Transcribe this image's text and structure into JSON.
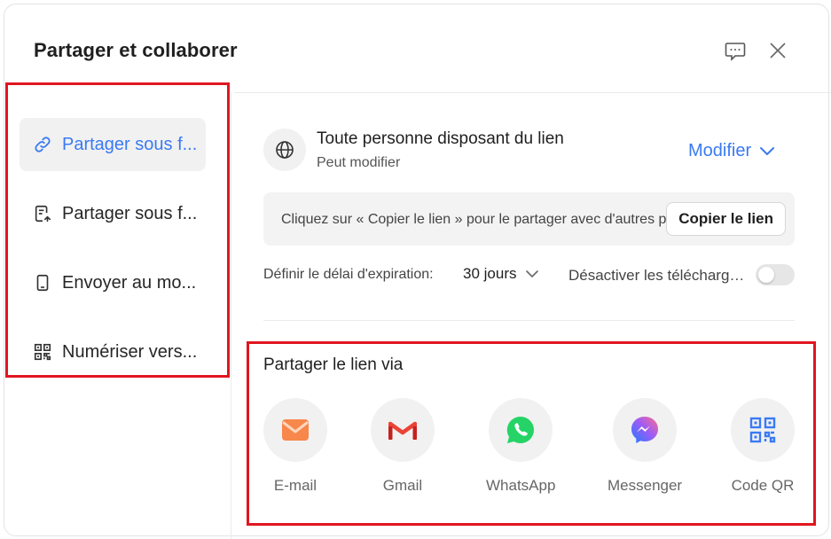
{
  "dialog": {
    "title": "Partager et collaborer",
    "feedback_icon": "comment-icon",
    "close_icon": "close-icon"
  },
  "sidebar": {
    "items": [
      {
        "label": "Partager sous f...",
        "icon": "link-icon",
        "active": true
      },
      {
        "label": "Partager sous f...",
        "icon": "file-share-icon",
        "active": false
      },
      {
        "label": "Envoyer au mo...",
        "icon": "mobile-icon",
        "active": false
      },
      {
        "label": "Numériser vers...",
        "icon": "qr-code-icon",
        "active": false
      }
    ]
  },
  "permission": {
    "title": "Toute personne disposant du lien",
    "subtitle": "Peut modifier",
    "modify_label": "Modifier"
  },
  "link": {
    "hint": "Cliquez sur « Copier le lien » pour le partager avec d'autres personnes",
    "copy_label": "Copier le lien"
  },
  "expiration": {
    "label": "Définir le délai d'expiration:",
    "value": "30 jours"
  },
  "download": {
    "label": "Désactiver les téléchargements",
    "enabled": false
  },
  "share_via": {
    "title": "Partager le lien via",
    "options": [
      {
        "label": "E-mail",
        "icon": "email-icon",
        "color": "#f7874b"
      },
      {
        "label": "Gmail",
        "icon": "gmail-icon",
        "color": "#ea4335"
      },
      {
        "label": "WhatsApp",
        "icon": "whatsapp-icon",
        "color": "#25d366"
      },
      {
        "label": "Messenger",
        "icon": "messenger-icon",
        "color": "#a05cf5"
      },
      {
        "label": "Code QR",
        "icon": "qr-code-icon",
        "color": "#3a7af2"
      }
    ]
  },
  "colors": {
    "accent": "#3a7af2",
    "highlight_border": "#e0161f"
  }
}
